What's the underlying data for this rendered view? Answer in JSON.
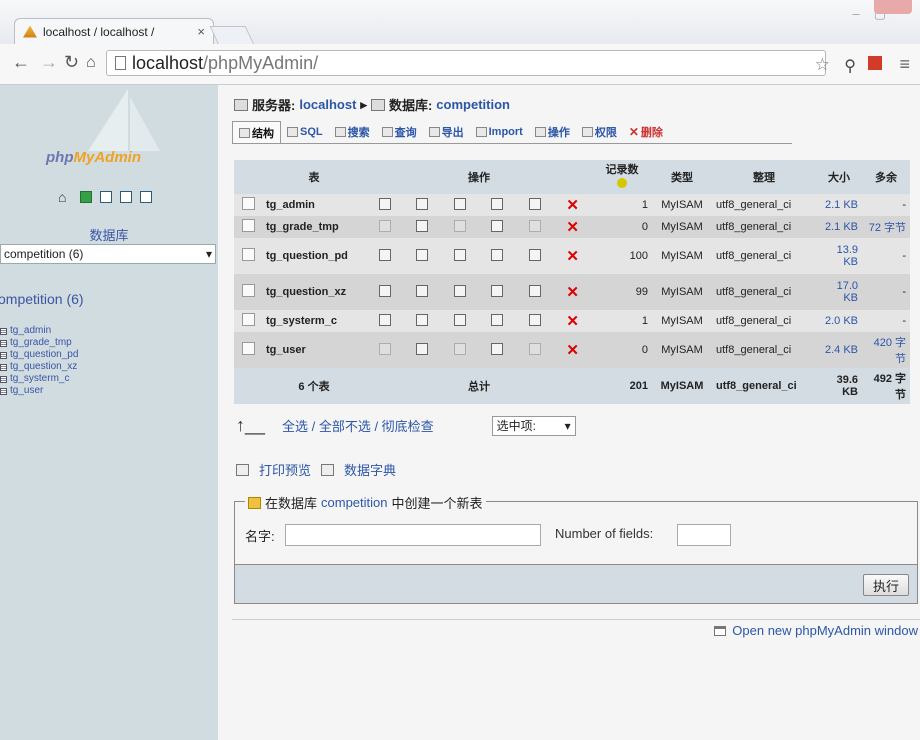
{
  "browser": {
    "tab_title": "localhost / localhost / ",
    "url_host": "localhost",
    "url_path": "/phpMyAdmin/"
  },
  "sidebar": {
    "logo_php": "php",
    "logo_myadmin": "MyAdmin",
    "db_label": "数据库",
    "db_select_value": "competition (6)",
    "db_heading": "ompetition (6)",
    "tables": [
      "tg_admin",
      "tg_grade_tmp",
      "tg_question_pd",
      "tg_question_xz",
      "tg_systerm_c",
      "tg_user"
    ]
  },
  "breadcrumb": {
    "server_key": "服务器:",
    "server_value": "localhost",
    "sep": "▸",
    "db_key": "数据库:",
    "db_value": "competition"
  },
  "menu": [
    "结构",
    "SQL",
    "搜索",
    "查询",
    "导出",
    "Import",
    "操作",
    "权限",
    "删除"
  ],
  "table_head": {
    "table": "表",
    "action": "操作",
    "records": "记录数",
    "type": "类型",
    "collation": "整理",
    "size": "大小",
    "overhead": "多余"
  },
  "rows": [
    {
      "name": "tg_admin",
      "records": "1",
      "type": "MyISAM",
      "collation": "utf8_general_ci",
      "size": "2.1 KB",
      "overhead": "-"
    },
    {
      "name": "tg_grade_tmp",
      "records": "0",
      "type": "MyISAM",
      "collation": "utf8_general_ci",
      "size": "2.1 KB",
      "overhead": "72 字节"
    },
    {
      "name": "tg_question_pd",
      "records": "100",
      "type": "MyISAM",
      "collation": "utf8_general_ci",
      "size": "13.9 KB",
      "overhead": "-"
    },
    {
      "name": "tg_question_xz",
      "records": "99",
      "type": "MyISAM",
      "collation": "utf8_general_ci",
      "size": "17.0 KB",
      "overhead": "-"
    },
    {
      "name": "tg_systerm_c",
      "records": "1",
      "type": "MyISAM",
      "collation": "utf8_general_ci",
      "size": "2.0 KB",
      "overhead": "-"
    },
    {
      "name": "tg_user",
      "records": "0",
      "type": "MyISAM",
      "collation": "utf8_general_ci",
      "size": "2.4 KB",
      "overhead": "420 字节"
    }
  ],
  "footer": {
    "count": "6 个表",
    "total": "总计",
    "records": "201",
    "type": "MyISAM",
    "collation": "utf8_general_ci",
    "size": "39.6 KB",
    "overhead": "492 字节"
  },
  "select_all": {
    "links": "全选 / 全部不选 / 彻底检查",
    "with_selected": "选中项:"
  },
  "print": {
    "preview": "打印预览",
    "dictionary": "数据字典"
  },
  "create_table": {
    "legend_prefix": "在数据库",
    "legend_db": "competition",
    "legend_suffix": "中创建一个新表",
    "name_label": "名字:",
    "fields_label": "Number of fields:",
    "exec_button": "执行"
  },
  "new_window": "Open new phpMyAdmin window"
}
